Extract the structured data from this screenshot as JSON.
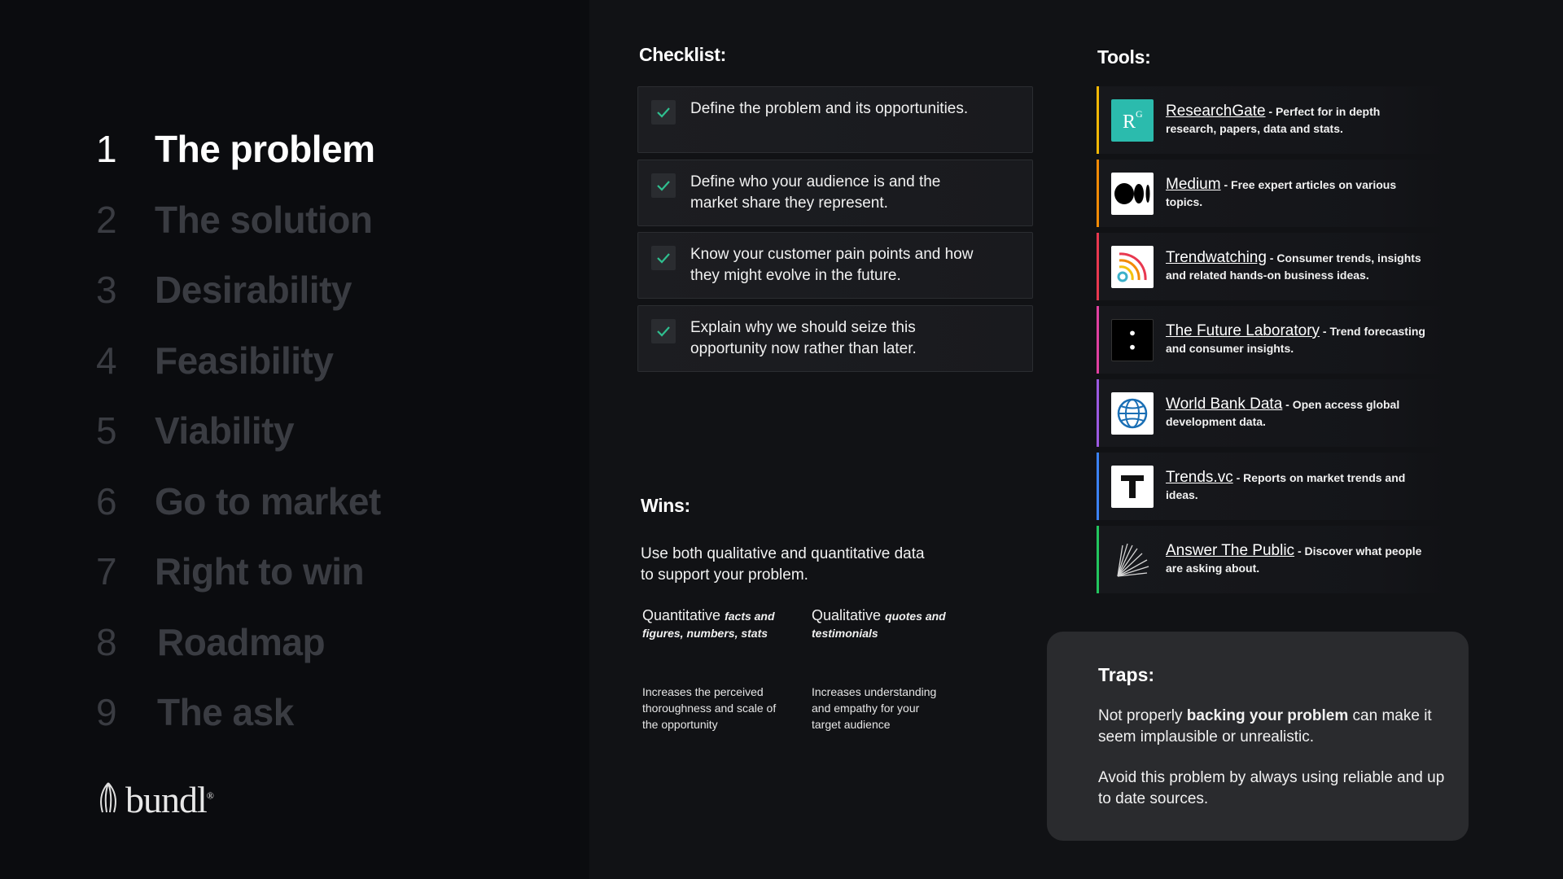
{
  "steps": [
    {
      "num": "1",
      "label": "The problem"
    },
    {
      "num": "2",
      "label": "The solution"
    },
    {
      "num": "3",
      "label": "Desirability"
    },
    {
      "num": "4",
      "label": "Feasibility"
    },
    {
      "num": "5",
      "label": "Viability"
    },
    {
      "num": "6",
      "label": "Go to market"
    },
    {
      "num": "7",
      "label": "Right to win"
    },
    {
      "num": "8",
      "label": "Roadmap"
    },
    {
      "num": "9",
      "label": "The ask"
    }
  ],
  "logo": {
    "text": "bundl",
    "reg": "®"
  },
  "checklist": {
    "title": "Checklist:",
    "items": [
      "Define the problem and its opportunities.",
      "Define who your audience is and the market share they represent.",
      "Know your customer pain points and how they might evolve in the future.",
      "Explain why we should seize this opportunity now rather than later."
    ]
  },
  "wins": {
    "title": "Wins:",
    "text": "Use both qualitative and quantitative data to support your problem.",
    "quant_head": "Quantitative",
    "quant_sub": "facts and figures, numbers, stats",
    "quant_desc": "Increases the perceived thoroughness and scale of the opportunity",
    "qual_head": "Qualitative",
    "qual_sub": "quotes and testimonials",
    "qual_desc": "Increases understanding and empathy for your target audience"
  },
  "tools": {
    "title": "Tools:",
    "items": [
      {
        "name": "ResearchGate",
        "desc": " - Perfect for in depth research, papers, data and stats.",
        "color": "#f2b705",
        "icon": "researchgate-icon"
      },
      {
        "name": "Medium",
        "desc": " - Free expert articles on various topics.",
        "color": "#f28a05",
        "icon": "medium-icon"
      },
      {
        "name": "Trendwatching",
        "desc": " - Consumer trends, insights and related hands-on business ideas.",
        "color": "#e8384f",
        "icon": "trendwatching-icon"
      },
      {
        "name": "The Future Laboratory",
        "desc": " - Trend forecasting and consumer insights.",
        "color": "#e040a0",
        "icon": "future-laboratory-icon"
      },
      {
        "name": "World Bank Data",
        "desc": " - Open access global development data.",
        "color": "#9b59e0",
        "icon": "globe-icon"
      },
      {
        "name": "Trends.vc",
        "desc": " - Reports on market trends and ideas.",
        "color": "#3b82f6",
        "icon": "trends-vc-icon"
      },
      {
        "name": "Answer The Public",
        "desc": " - Discover what people are asking about.",
        "color": "#22c55e",
        "icon": "answer-the-public-icon"
      }
    ]
  },
  "traps": {
    "title": "Traps:",
    "p1_pre": "Not properly ",
    "p1_bold": "backing your problem",
    "p1_post": " can make it seem implausible or unrealistic.",
    "p2": "Avoid this problem by always using reliable and up to date sources."
  }
}
